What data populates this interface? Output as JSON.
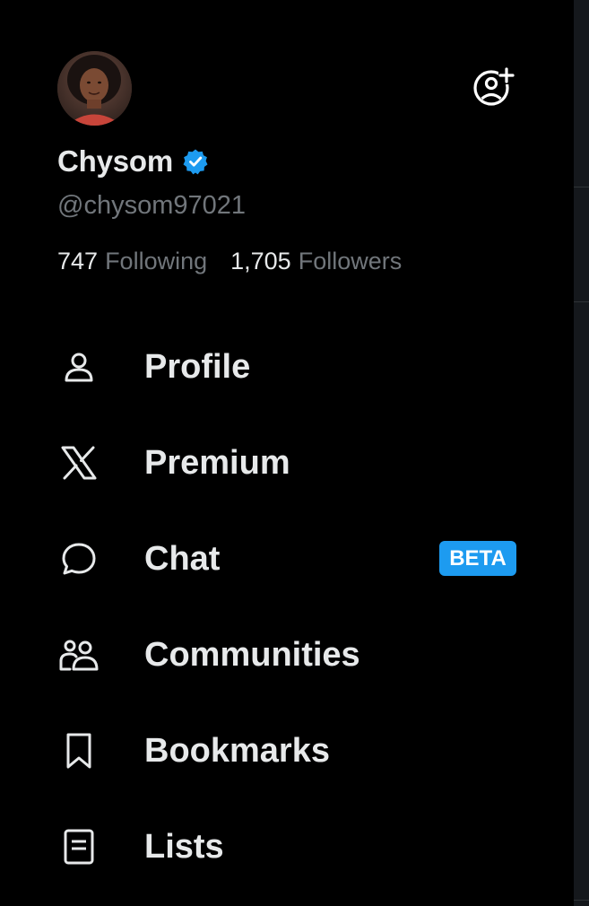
{
  "profile": {
    "name": "Chysom",
    "handle": "@chysom97021",
    "following_count": "747",
    "following_label": "Following",
    "followers_count": "1,705",
    "followers_label": "Followers",
    "verified_icon": "verified-badge-icon"
  },
  "header": {
    "add_account_icon": "add-account-icon"
  },
  "menu": {
    "items": [
      {
        "label": "Profile",
        "icon": "person-icon"
      },
      {
        "label": "Premium",
        "icon": "x-logo-icon"
      },
      {
        "label": "Chat",
        "icon": "chat-bubble-icon",
        "badge": "BETA"
      },
      {
        "label": "Communities",
        "icon": "communities-icon"
      },
      {
        "label": "Bookmarks",
        "icon": "bookmark-icon"
      },
      {
        "label": "Lists",
        "icon": "lists-icon"
      }
    ]
  },
  "colors": {
    "background": "#000000",
    "text_primary": "#e7e9ea",
    "text_secondary": "#71767b",
    "accent": "#1d9bf0"
  }
}
